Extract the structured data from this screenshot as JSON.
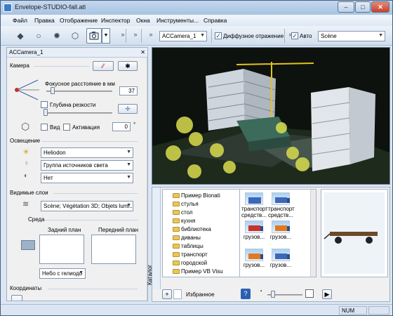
{
  "window": {
    "title": "Envelope-STUDIO-fall.atl",
    "minimize": "–",
    "maximize": "□",
    "close": "✕"
  },
  "menu": [
    "Файл",
    "Правка",
    "Отображение",
    "Инспектор",
    "Окна",
    "Инструменты...",
    "Справка"
  ],
  "toolbar": {
    "camera_select": "ACCamera_1",
    "diffuse_reflection_label": "Диффузное отражение",
    "diffuse_reflection_checked": true,
    "auto_label": "Авто",
    "auto_checked": true,
    "scene_select": "Scène",
    "overflow_glyph": "»"
  },
  "inspector": {
    "title": "ACCamera_1",
    "close": "✕",
    "camera_section": "Камера",
    "focal_length_label": "Фокусное расстояние в мм",
    "focal_length_value": "37",
    "focal_length_fraction": 0.1,
    "depth_of_field_label": "Глубина резкости",
    "depth_of_field_checked": false,
    "view_label": "Вид",
    "view_checked": false,
    "activation_label": "Активация",
    "activation_checked": false,
    "activation_value": "0",
    "degree_sign": "°",
    "lighting_section": "Освещение",
    "light_select": "Heliodon",
    "light_group_select": "Группа источников света",
    "shadow_select": "Нет",
    "visible_layers_section": "Видимые слои",
    "layers_select": "Scène; Végétation 3D; Objets lumi...",
    "environment_label": "Среда",
    "background_label": "Задний план",
    "foreground_label": "Передний план",
    "sky_select": "Небо с гелиодо",
    "coordinates_section": "Координаты"
  },
  "catalog": {
    "title": "Каталог",
    "folders": [
      "Пример Bionati",
      "стулья",
      "стол",
      "кухня",
      "библиотека",
      "диваны",
      "таблицы",
      "транспорт",
      "городской",
      "Пример VB Visu"
    ],
    "items": [
      {
        "label": "транспорт средств...",
        "icon": "bus-icon"
      },
      {
        "label": "транспорт средств...",
        "icon": "truck-icon"
      },
      {
        "label": "грузов...",
        "icon": "truck-icon"
      },
      {
        "label": "грузов...",
        "icon": "truck-icon"
      },
      {
        "label": "грузов...",
        "icon": "truck-icon"
      },
      {
        "label": "грузов...",
        "icon": "truck-icon"
      },
      {
        "label": "грузов...",
        "icon": "truck-icon"
      },
      {
        "label": "грузов...",
        "icon": "truck-icon"
      }
    ],
    "favorites_label": "Избранное",
    "add": "+",
    "play": "▶",
    "size_slider_fraction": 0.15
  },
  "status": {
    "num": "NUM"
  },
  "colors": {
    "accent": "#3b7bc9",
    "viewport_bg": "#0f1410",
    "building": "#d7dce2",
    "crane": "#e5c11b",
    "trees": "#d9dd4e"
  }
}
